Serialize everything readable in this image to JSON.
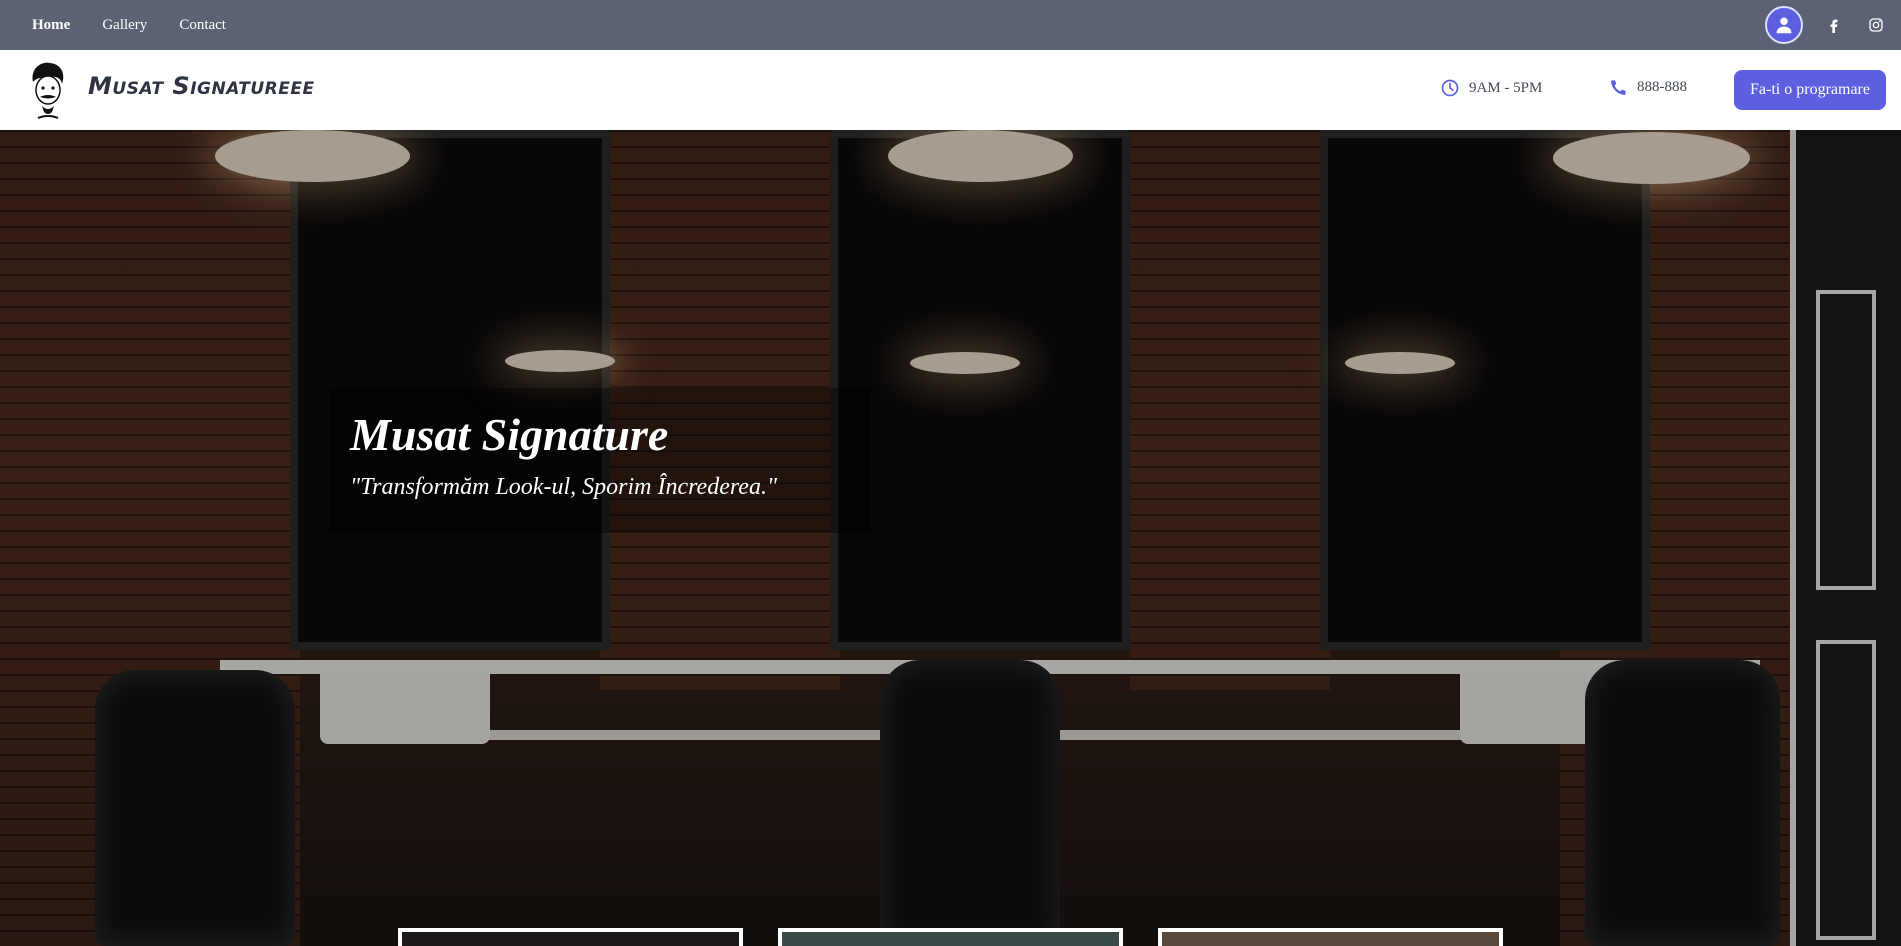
{
  "topnav": {
    "items": [
      {
        "label": "Home",
        "active": true
      },
      {
        "label": "Gallery",
        "active": false
      },
      {
        "label": "Contact",
        "active": false
      }
    ],
    "icons": [
      "user-icon",
      "facebook-icon",
      "instagram-icon"
    ]
  },
  "header": {
    "brand": "Musat Signatureee",
    "hours": "9AM - 5PM",
    "phone": "888-888",
    "cta_label": "Fa-ti o programare",
    "accent_color": "#5b5fe0"
  },
  "hero": {
    "title": "Musat Signature",
    "subtitle": "\"Transformăm Look-ul, Sporim Încrederea.\""
  }
}
